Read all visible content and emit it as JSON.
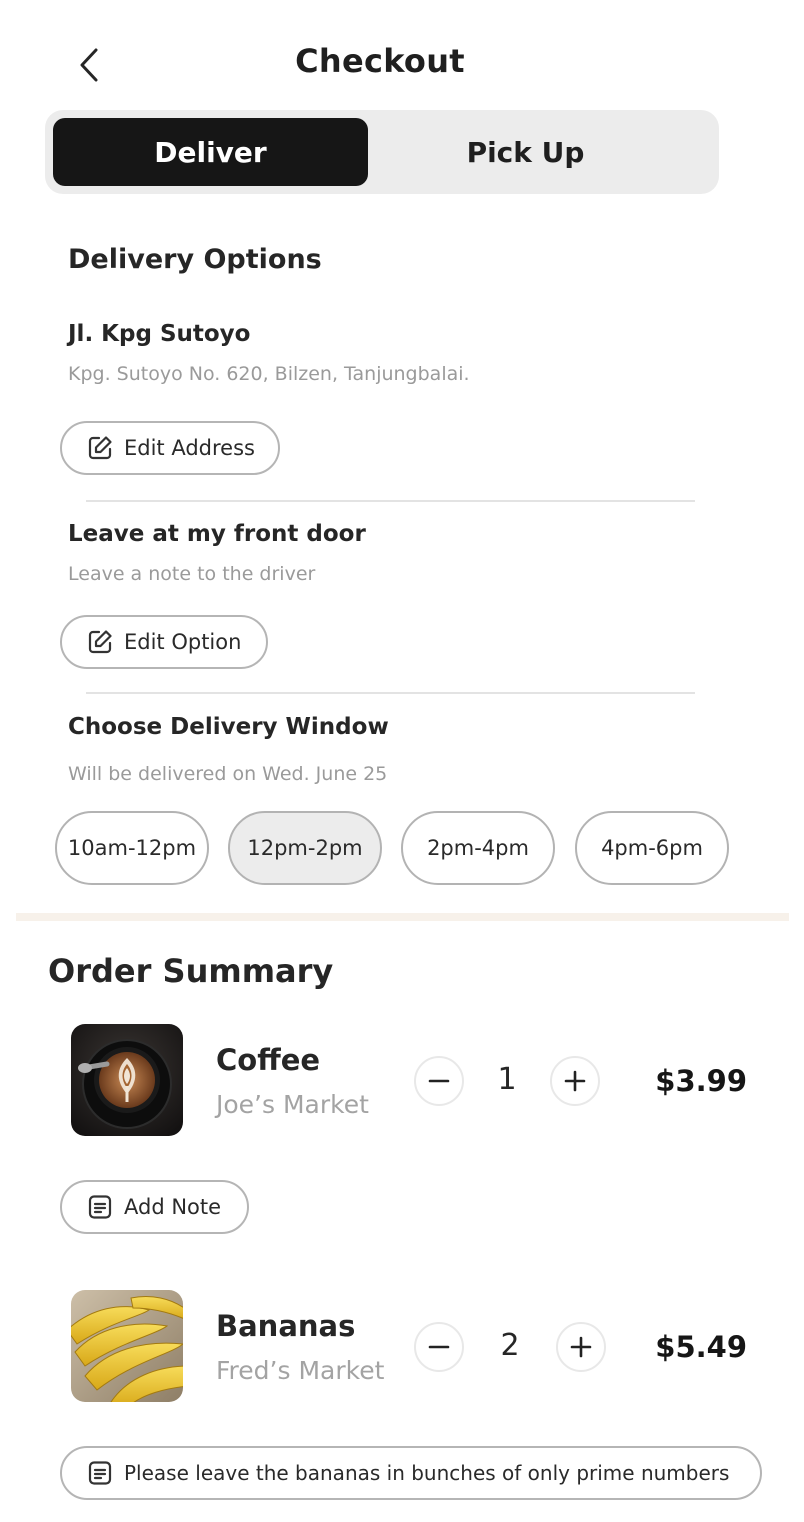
{
  "header": {
    "title": "Checkout",
    "back_icon": "chevron-left-icon"
  },
  "mode_tabs": [
    {
      "label": "Deliver",
      "selected": true
    },
    {
      "label": "Pick Up",
      "selected": false
    }
  ],
  "delivery": {
    "section_title": "Delivery Options",
    "address_name": "Jl. Kpg Sutoyo",
    "address_detail": "Kpg. Sutoyo No. 620, Bilzen, Tanjungbalai.",
    "edit_address_label": "Edit Address",
    "dropoff_title": "Leave at my front door",
    "dropoff_sub": "Leave a note to the driver",
    "edit_option_label": "Edit Option",
    "window_title": "Choose Delivery Window",
    "window_sub": "Will be delivered on Wed. June 25",
    "windows": [
      {
        "label": "10am-12pm",
        "selected": false
      },
      {
        "label": "12pm-2pm",
        "selected": true
      },
      {
        "label": "2pm-4pm",
        "selected": false
      },
      {
        "label": "4pm-6pm",
        "selected": false
      }
    ]
  },
  "order": {
    "title": "Order Summary",
    "items": [
      {
        "name": "Coffee",
        "store": "Joe’s Market",
        "qty": "1",
        "price": "$3.99",
        "note_label": "Add Note",
        "image_icon": "coffee-image"
      },
      {
        "name": "Bananas",
        "store": "Fred’s Market",
        "qty": "2",
        "price": "$5.49",
        "note_label": "Please leave the bananas in bunches of only prime numbers",
        "image_icon": "bananas-image"
      }
    ]
  },
  "colors": {
    "accent_dark": "#161616",
    "segment_bg": "#ececec",
    "muted_text": "#9a9a9a",
    "section_band": "#f7f1ea"
  }
}
